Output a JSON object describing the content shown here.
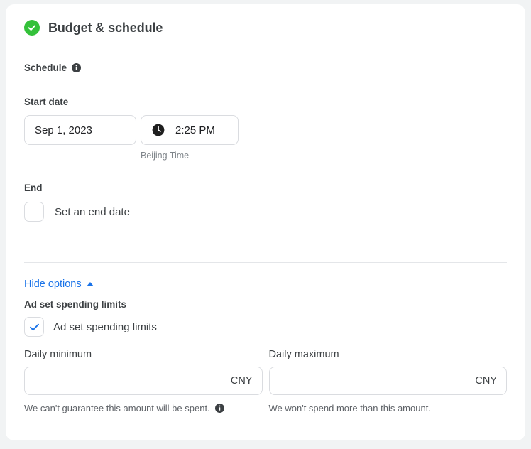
{
  "header": {
    "title": "Budget & schedule",
    "status_icon": "check-circle-icon",
    "status_color": "#34c13a"
  },
  "schedule": {
    "section_label": "Schedule",
    "section_info_icon": "info-icon",
    "start_date": {
      "label": "Start date",
      "date_value": "Sep 1, 2023",
      "time_icon": "clock-icon",
      "time_value": "2:25 PM",
      "timezone_caption": "Beijing Time"
    },
    "end": {
      "label": "End",
      "checkbox_label": "Set an end date",
      "checked": false
    }
  },
  "options": {
    "toggle_label": "Hide options",
    "toggle_icon": "caret-up-icon",
    "link_color": "#1a73e8"
  },
  "spending_limits": {
    "heading": "Ad set spending limits",
    "checkbox_label": "Ad set spending limits",
    "checked": true,
    "check_color": "#1a73e8",
    "daily_minimum": {
      "label": "Daily minimum",
      "value": "",
      "currency": "CNY",
      "helper": "We can't guarantee this amount will be spent.",
      "helper_info_icon": "info-icon"
    },
    "daily_maximum": {
      "label": "Daily maximum",
      "value": "",
      "currency": "CNY",
      "helper": "We won't spend more than this amount."
    }
  }
}
